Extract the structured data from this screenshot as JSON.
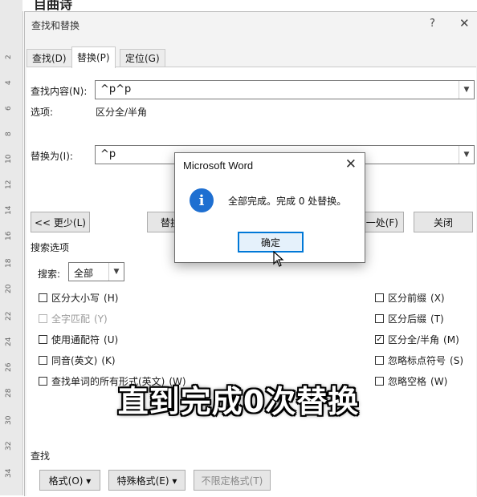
{
  "document": {
    "top_text": "目曲诗"
  },
  "ruler": {
    "numbers": [
      "2",
      "4",
      "6",
      "8",
      "10",
      "12",
      "14",
      "16",
      "18",
      "20",
      "22",
      "24",
      "26",
      "28",
      "30",
      "32",
      "34"
    ]
  },
  "dialog": {
    "title": "查找和替换",
    "help_symbol": "?",
    "close_symbol": "✕",
    "tabs": [
      {
        "label": "查找(D)",
        "active": false
      },
      {
        "label": "替换(P)",
        "active": true
      },
      {
        "label": "定位(G)",
        "active": false
      }
    ],
    "find": {
      "label": "查找内容(N):",
      "value": "^p^p",
      "options_label": "选项:",
      "options_value": "区分全/半角"
    },
    "replace": {
      "label": "替换为(I):",
      "value": "^p"
    },
    "buttons": {
      "less": "<< 更少(L)",
      "replace_partial": "替换",
      "find_next_partial": "一处(F)",
      "close": "关闭"
    },
    "search_options": {
      "title": "搜索选项",
      "search_label": "搜索:",
      "search_value": "全部"
    },
    "checkboxes_left": [
      {
        "label": "区分大小写",
        "key": "(H)",
        "checked": false,
        "disabled": false
      },
      {
        "label": "全字匹配",
        "key": "(Y)",
        "checked": false,
        "disabled": true
      },
      {
        "label": "使用通配符",
        "key": "(U)",
        "checked": false,
        "disabled": false
      },
      {
        "label": "同音(英文)",
        "key": "(K)",
        "checked": false,
        "disabled": false
      },
      {
        "label": "查找单词的所有形式(英文)",
        "key": "(W)",
        "checked": false,
        "disabled": false
      }
    ],
    "checkboxes_right": [
      {
        "label": "区分前缀",
        "key": "(X)",
        "checked": false
      },
      {
        "label": "区分后缀",
        "key": "(T)",
        "checked": false
      },
      {
        "label": "区分全/半角",
        "key": "(M)",
        "checked": true
      },
      {
        "label": "忽略标点符号",
        "key": "(S)",
        "checked": false
      },
      {
        "label": "忽略空格",
        "key": "(W)",
        "checked": false
      }
    ],
    "find_section": {
      "title": "查找",
      "format_button": "格式(O) ▾",
      "special_button": "特殊格式(E) ▾",
      "no_format_button": "不限定格式(T)"
    }
  },
  "message_box": {
    "title": "Microsoft Word",
    "close_symbol": "✕",
    "icon": "info-icon",
    "icon_glyph": "i",
    "message": "全部完成。完成 0 处替换。",
    "ok_label": "确定"
  },
  "caption": "直到完成0次替换",
  "colors": {
    "accent": "#0078d7",
    "info_icon": "#1e6fd1",
    "dialog_bg": "#f3f3f3"
  }
}
